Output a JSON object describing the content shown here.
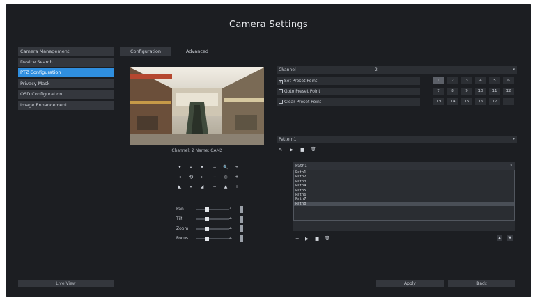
{
  "title": "Camera Settings",
  "sidebar": {
    "items": [
      {
        "label": "Camera Management",
        "active": false
      },
      {
        "label": "Device Search",
        "active": false
      },
      {
        "label": "PTZ Configuration",
        "active": true
      },
      {
        "label": "Privacy Mask",
        "active": false
      },
      {
        "label": "OSD Configuration",
        "active": false
      },
      {
        "label": "Image Enhancement",
        "active": false
      }
    ],
    "live_view_label": "Live View"
  },
  "tabs": [
    {
      "label": "Configuration",
      "active": true
    },
    {
      "label": "Advanced",
      "active": false
    }
  ],
  "preview": {
    "caption": "Channel: 2 Name: CAM2"
  },
  "ptz_pad": {
    "rows": [
      [
        "▾",
        "▴",
        "▾",
        "−",
        "🔍",
        "+"
      ],
      [
        "◂",
        "⟲",
        "▸",
        "−",
        "◎",
        "+"
      ],
      [
        "◣",
        "▾",
        "◢",
        "−",
        "▲",
        "+"
      ]
    ]
  },
  "sliders": [
    {
      "label": "Pan",
      "value": "4"
    },
    {
      "label": "Tilt",
      "value": "4"
    },
    {
      "label": "Zoom",
      "value": "4"
    },
    {
      "label": "Focus",
      "value": "4"
    }
  ],
  "channel": {
    "label": "Channel",
    "value": "2"
  },
  "preset_options": [
    {
      "label": "Set Preset Point",
      "checked": true
    },
    {
      "label": "Goto Preset Point",
      "checked": false
    },
    {
      "label": "Clear Preset Point",
      "checked": false
    }
  ],
  "preset_numbers": [
    [
      "1",
      "2",
      "3",
      "4",
      "5",
      "6"
    ],
    [
      "7",
      "8",
      "9",
      "10",
      "11",
      "12"
    ],
    [
      "13",
      "14",
      "15",
      "16",
      "17",
      "..."
    ]
  ],
  "pattern": {
    "value": "Pattern1",
    "icons": [
      "✎",
      "▶",
      "■",
      "🗑"
    ]
  },
  "path": {
    "value": "Path1",
    "items": [
      "Path1",
      "Path2",
      "Path3",
      "Path4",
      "Path5",
      "Path6",
      "Path7",
      "Path8"
    ],
    "selected_index": 7,
    "icons": [
      "+",
      "▶",
      "■",
      "🗑"
    ]
  },
  "buttons": {
    "apply": "Apply",
    "back": "Back"
  },
  "colors": {
    "accent": "#2f8fe0",
    "background": "#1c1e22",
    "panel": "#34373d"
  }
}
